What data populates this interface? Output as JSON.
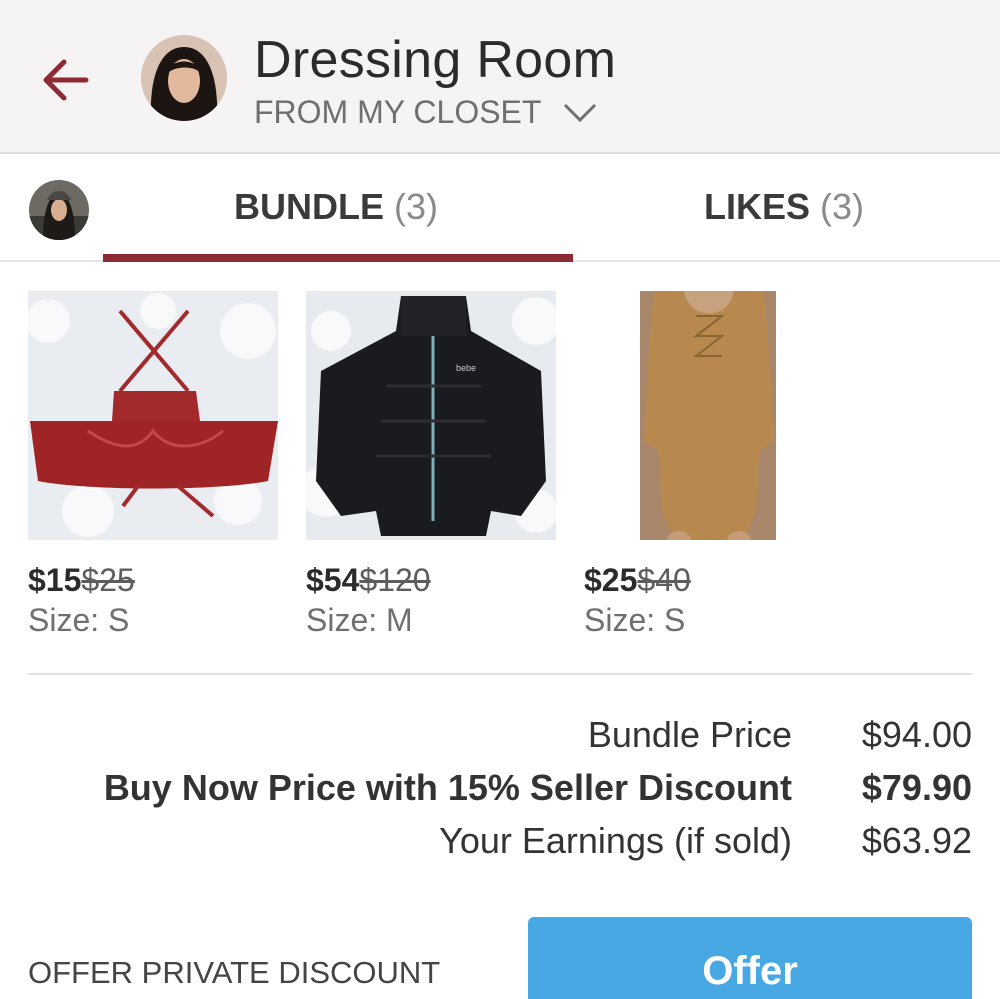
{
  "header": {
    "title": "Dressing Room",
    "subtitle": "FROM MY CLOSET"
  },
  "tabs": [
    {
      "label": "BUNDLE",
      "count": "(3)",
      "active": true
    },
    {
      "label": "LIKES",
      "count": "(3)",
      "active": false
    }
  ],
  "items": [
    {
      "price": "$15",
      "original_price": "$25",
      "size": "Size: S"
    },
    {
      "price": "$54",
      "original_price": "$120",
      "size": "Size: M"
    },
    {
      "price": "$25",
      "original_price": "$40",
      "size": "Size: S"
    }
  ],
  "summary": {
    "bundle_price_label": "Bundle Price",
    "bundle_price": "$94.00",
    "buy_now_label": "Buy Now Price with 15% Seller Discount",
    "buy_now_price": "$79.90",
    "earnings_label": "Your Earnings (if sold)",
    "earnings": "$63.92"
  },
  "footer": {
    "private_discount_label": "OFFER PRIVATE DISCOUNT",
    "offer_button_label": "Offer"
  },
  "colors": {
    "accent": "#8e2a34",
    "button": "#48a8e4"
  },
  "icons": [
    "back-arrow-icon",
    "chevron-down-icon"
  ]
}
